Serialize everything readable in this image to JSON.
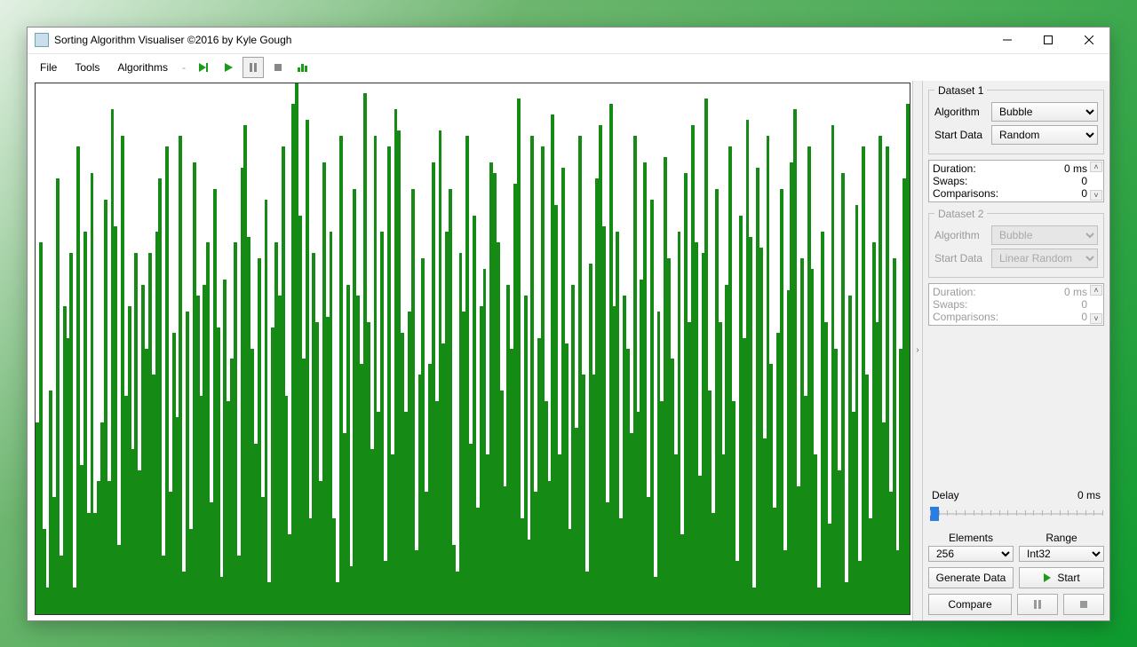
{
  "window": {
    "title": "Sorting Algorithm Visualiser ©2016 by Kyle Gough"
  },
  "menu": {
    "file": "File",
    "tools": "Tools",
    "algorithms": "Algorithms"
  },
  "panel": {
    "dataset1": {
      "legend": "Dataset 1",
      "algo_label": "Algorithm",
      "algo_value": "Bubble",
      "start_label": "Start Data",
      "start_value": "Random",
      "stats": {
        "duration_k": "Duration:",
        "duration_v": "0 ms",
        "swaps_k": "Swaps:",
        "swaps_v": "0",
        "comp_k": "Comparisons:",
        "comp_v": "0"
      }
    },
    "dataset2": {
      "legend": "Dataset 2",
      "algo_label": "Algorithm",
      "algo_value": "Bubble",
      "start_label": "Start Data",
      "start_value": "Linear Random",
      "stats": {
        "duration_k": "Duration:",
        "duration_v": "0 ms",
        "swaps_k": "Swaps:",
        "swaps_v": "0",
        "comp_k": "Comparisons:",
        "comp_v": "0"
      }
    },
    "delay": {
      "label": "Delay",
      "value": "0 ms"
    },
    "elements": {
      "label": "Elements",
      "value": "256"
    },
    "range": {
      "label": "Range",
      "value": "Int32"
    },
    "buttons": {
      "generate": "Generate Data",
      "start": "Start",
      "compare": "Compare"
    }
  },
  "chart_data": {
    "type": "bar",
    "title": "",
    "xlabel": "",
    "ylabel": "",
    "ylim": [
      0,
      100
    ],
    "categories_count": 256,
    "values": [
      36,
      70,
      16,
      5,
      42,
      22,
      82,
      11,
      58,
      52,
      68,
      5,
      88,
      28,
      72,
      19,
      83,
      19,
      25,
      36,
      78,
      25,
      95,
      73,
      13,
      90,
      41,
      58,
      31,
      68,
      27,
      62,
      50,
      68,
      45,
      72,
      82,
      11,
      88,
      23,
      53,
      37,
      90,
      8,
      57,
      16,
      85,
      60,
      41,
      62,
      70,
      21,
      80,
      54,
      7,
      63,
      40,
      48,
      70,
      11,
      84,
      92,
      71,
      50,
      32,
      67,
      22,
      78,
      6,
      54,
      70,
      60,
      88,
      41,
      15,
      96,
      100,
      75,
      48,
      93,
      18,
      68,
      55,
      25,
      85,
      56,
      72,
      18,
      6,
      90,
      34,
      62,
      9,
      80,
      60,
      47,
      98,
      55,
      31,
      90,
      38,
      72,
      10,
      88,
      30,
      95,
      91,
      53,
      38,
      57,
      80,
      12,
      45,
      67,
      23,
      47,
      85,
      40,
      91,
      51,
      72,
      80,
      13,
      8,
      68,
      57,
      90,
      32,
      75,
      20,
      58,
      65,
      30,
      85,
      83,
      70,
      42,
      24,
      62,
      50,
      81,
      97,
      18,
      60,
      14,
      90,
      23,
      52,
      88,
      40,
      25,
      94,
      77,
      30,
      84,
      51,
      16,
      62,
      35,
      90,
      45,
      8,
      66,
      45,
      82,
      92,
      73,
      21,
      96,
      58,
      72,
      18,
      60,
      50,
      34,
      90,
      38,
      63,
      85,
      22,
      78,
      7,
      57,
      40,
      86,
      67,
      48,
      30,
      72,
      15,
      83,
      55,
      92,
      70,
      26,
      68,
      97,
      42,
      19,
      80,
      55,
      30,
      62,
      88,
      40,
      10,
      75,
      52,
      93,
      71,
      5,
      84,
      69,
      33,
      90,
      47,
      20,
      53,
      80,
      12,
      61,
      85,
      95,
      24,
      67,
      41,
      88,
      65,
      30,
      5,
      72,
      55,
      17,
      92,
      50,
      27,
      83,
      6,
      60,
      38,
      77,
      10,
      88,
      45,
      18,
      70,
      55,
      90,
      36,
      88,
      23,
      67,
      12,
      50,
      82,
      96
    ]
  }
}
